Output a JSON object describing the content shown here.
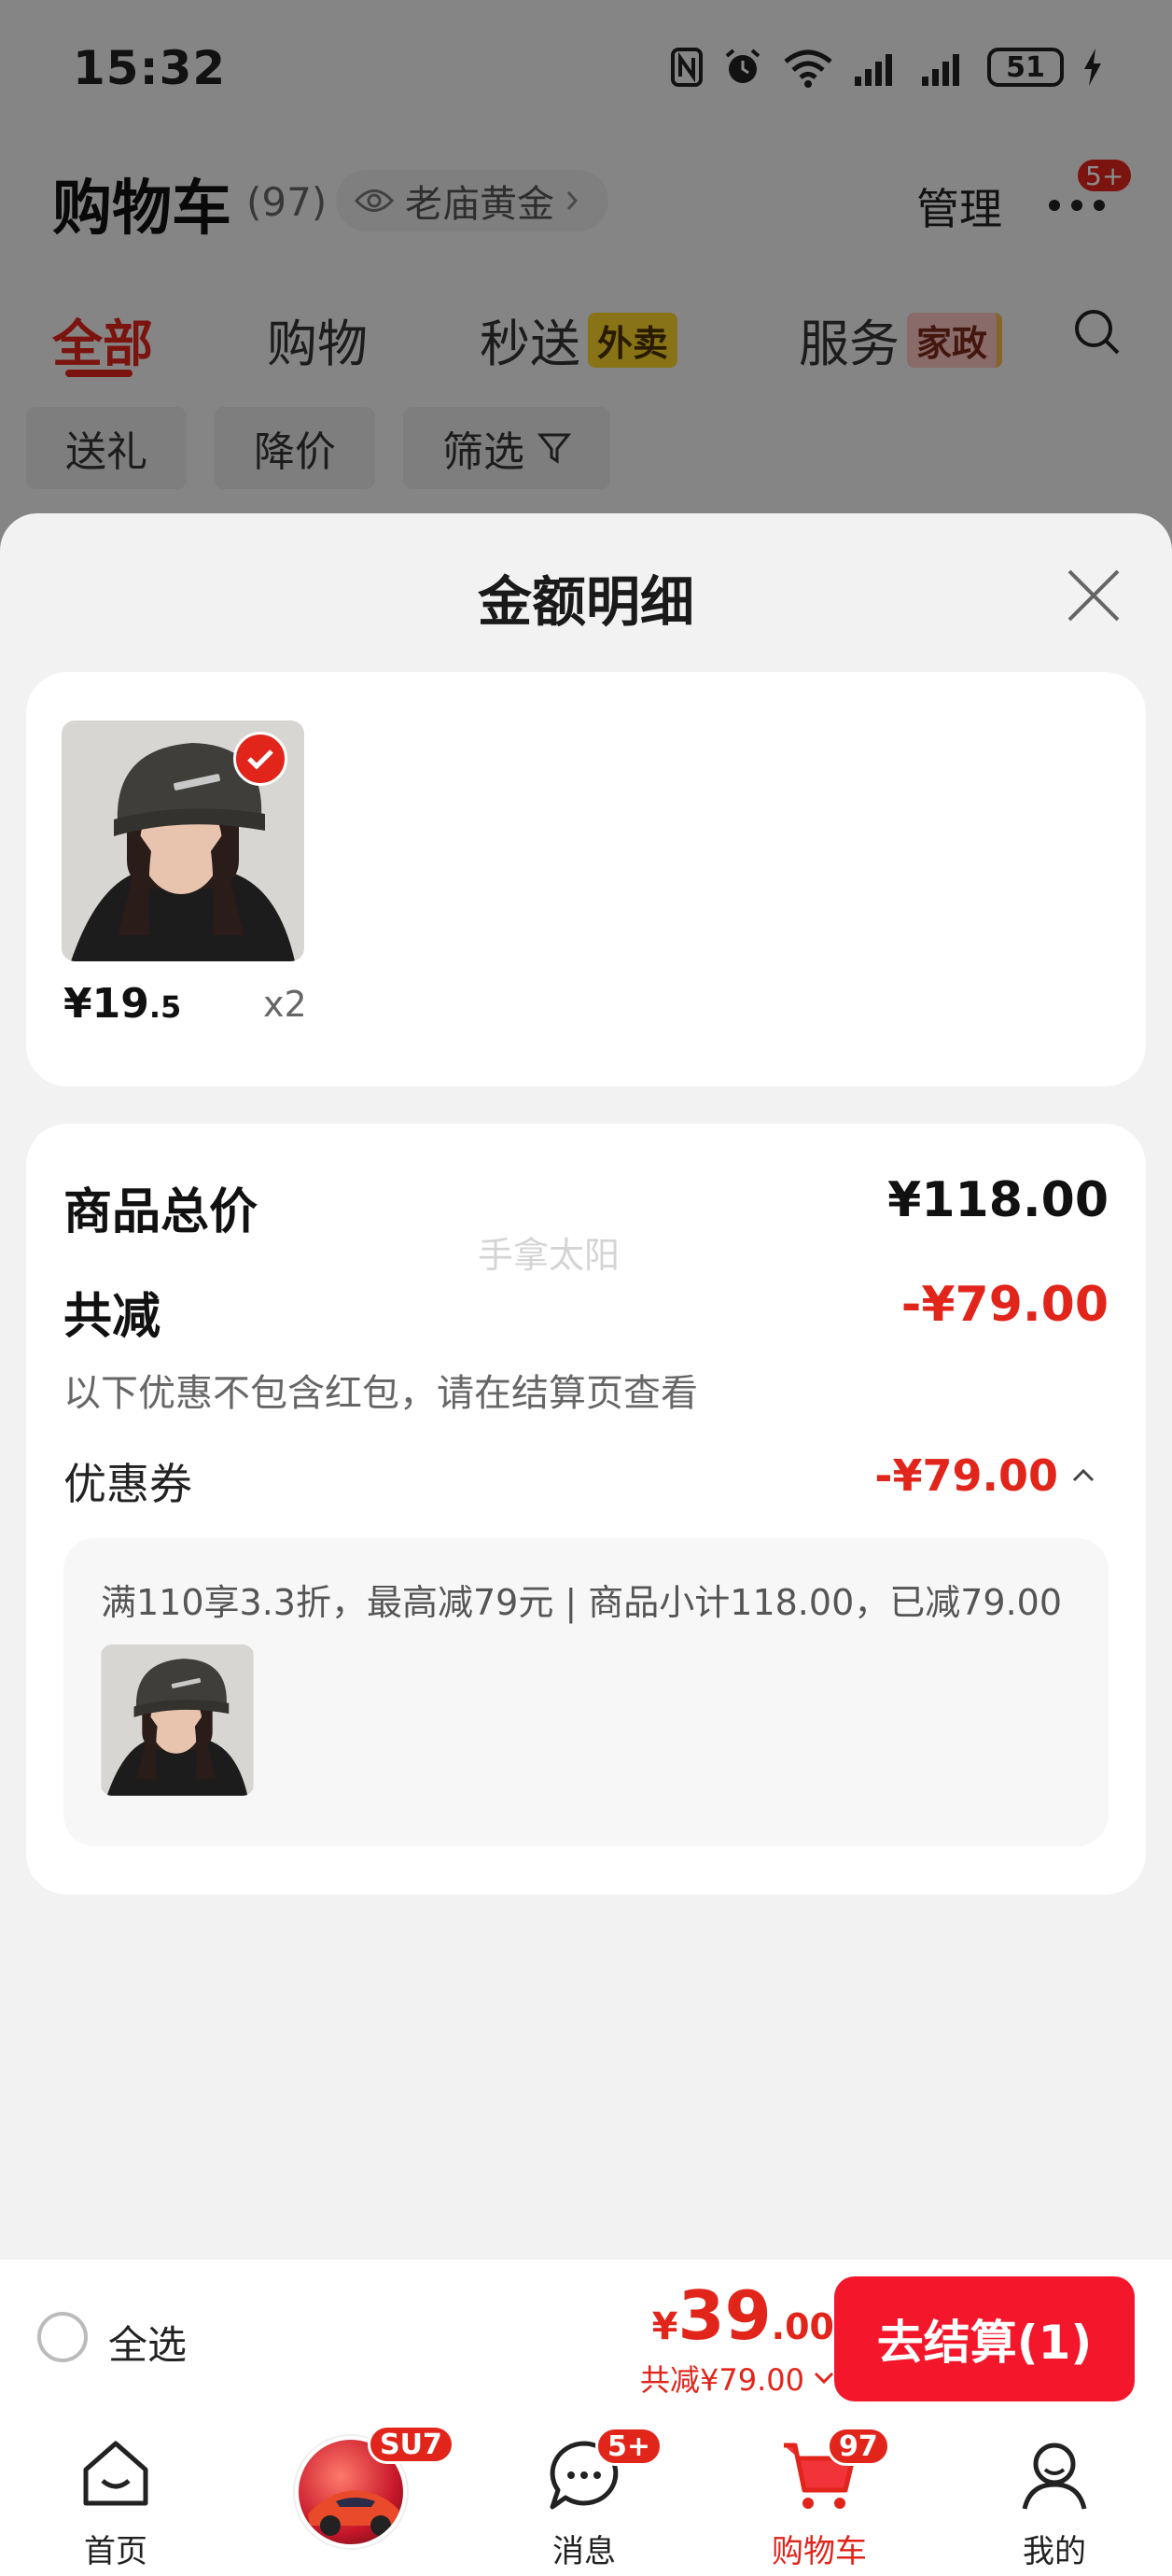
{
  "status_bar": {
    "time": "15:32",
    "battery": "51"
  },
  "header": {
    "title": "购物车",
    "count": "(97)",
    "store_pill": "老庙黄金",
    "manage": "管理",
    "more_badge": "5+"
  },
  "tabs": [
    {
      "label": "全部"
    },
    {
      "label": "购物"
    },
    {
      "label": "秒送",
      "tag": "外卖"
    },
    {
      "label": "服务",
      "tag": "家政"
    }
  ],
  "chips": [
    "送礼",
    "降价",
    "筛选"
  ],
  "sheet": {
    "title": "金额明细",
    "product": {
      "price_int": "¥19",
      "price_dec": ".5",
      "qty": "x2"
    },
    "summary": {
      "total_label": "商品总价",
      "total_value": "¥118.00",
      "discount_label": "共减",
      "discount_value": "-¥79.00",
      "note": "以下优惠不包含红包，请在结算页查看",
      "coupon_label": "优惠券",
      "coupon_value": "-¥79.00",
      "watermark": "手拿太阳"
    },
    "coupon_detail": "满110享3.3折，最高减79元 | 商品小计118.00，已减79.00"
  },
  "checkout": {
    "select_all": "全选",
    "total_yen": "¥",
    "total_int": "39",
    "total_dec": ".00",
    "saved": "共减¥79.00",
    "button": "去结算(1)"
  },
  "bottom_nav": {
    "home": "首页",
    "promo_badge": "SU7",
    "messages": "消息",
    "messages_badge": "5+",
    "cart": "购物车",
    "cart_badge": "97",
    "mine": "我的"
  },
  "colors": {
    "accent": "#e1251b",
    "button": "#f4162a"
  }
}
